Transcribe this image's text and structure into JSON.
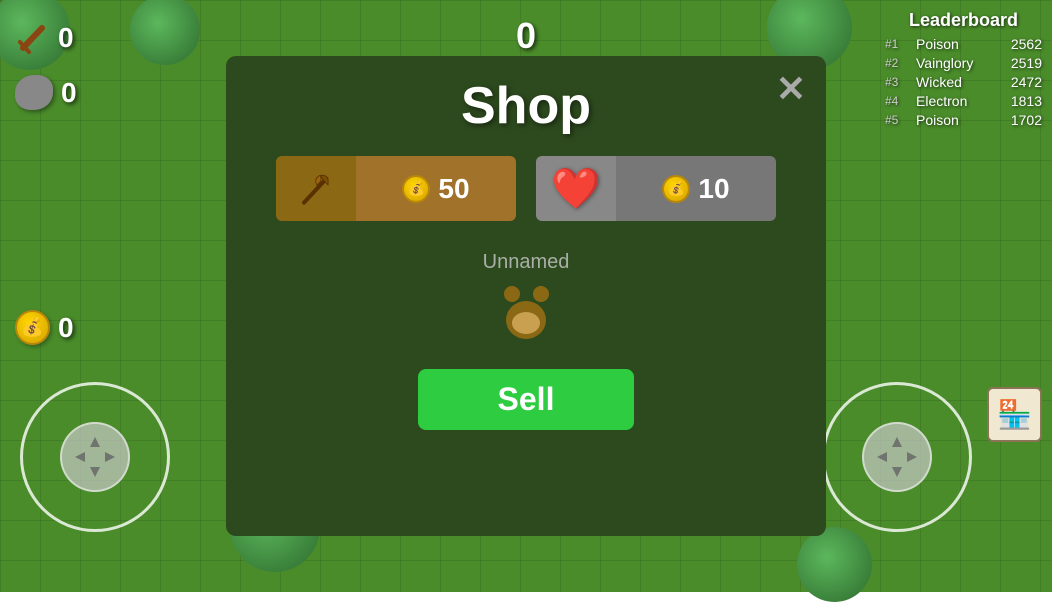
{
  "game": {
    "center_score": "0",
    "background_color": "#4a8c2a"
  },
  "hud": {
    "wood_count": "0",
    "stone_count": "0",
    "coin_count": "0"
  },
  "leaderboard": {
    "title": "Leaderboard",
    "entries": [
      {
        "rank": "#1",
        "name": "Poison",
        "score": "2562"
      },
      {
        "rank": "#2",
        "name": "Vainglory",
        "score": "2519"
      },
      {
        "rank": "#3",
        "name": "Wicked",
        "score": "2472"
      },
      {
        "rank": "#4",
        "name": "Electron",
        "score": "1813"
      },
      {
        "rank": "#5",
        "name": "Poison",
        "score": "1702"
      }
    ]
  },
  "shop": {
    "title": "Shop",
    "close_label": "✕",
    "items": [
      {
        "id": "axe",
        "icon": "axe",
        "price": "50"
      },
      {
        "id": "heart",
        "icon": "❤️",
        "price": "10"
      }
    ],
    "player_name": "Unnamed",
    "sell_button_label": "Sell"
  }
}
